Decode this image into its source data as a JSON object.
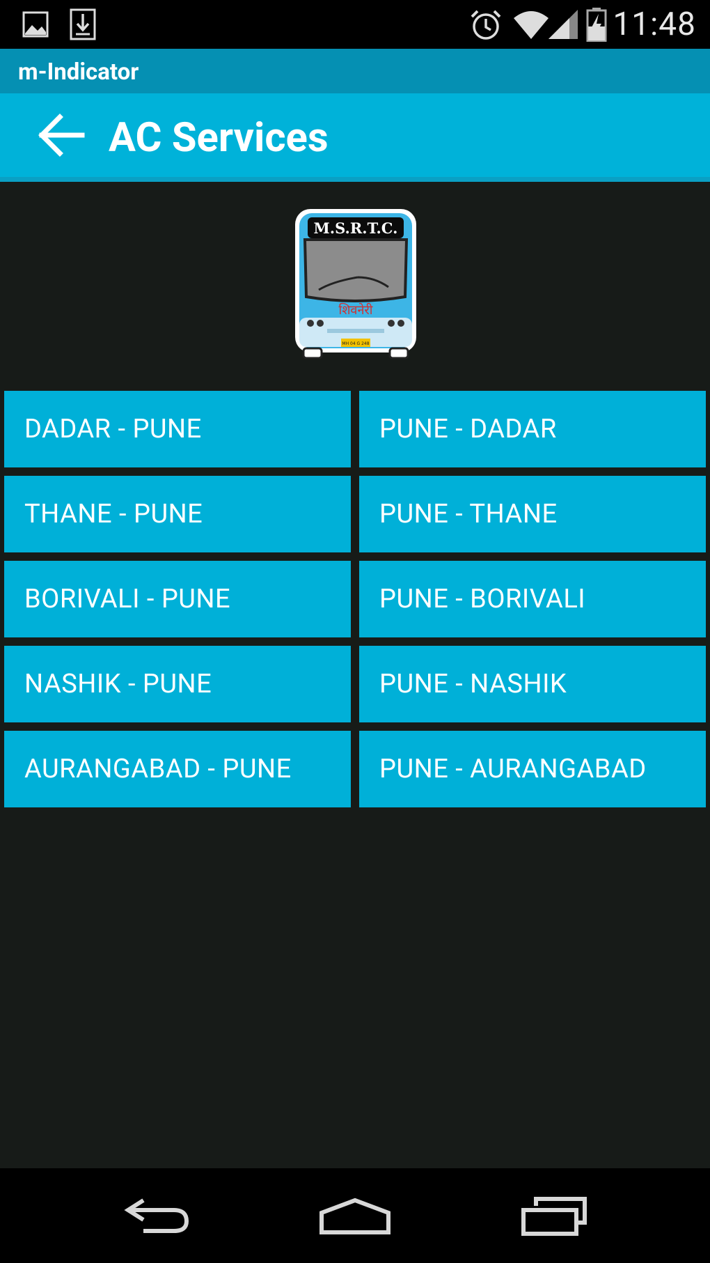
{
  "status_bar": {
    "time": "11:48",
    "icons": [
      "image-icon",
      "download-icon",
      "alarm-icon",
      "wifi-icon",
      "signal-icon",
      "battery-charging-icon"
    ]
  },
  "app": {
    "name": "m-Indicator"
  },
  "header": {
    "title": "AC Services",
    "back_icon": "back-arrow-icon"
  },
  "logo": {
    "name": "msrtc-bus-logo",
    "text": "M.S.R.T.C.",
    "subtext": "शिवनेरी",
    "plate": "MH 04 G 248"
  },
  "routes": [
    "DADAR - PUNE",
    "PUNE - DADAR",
    "THANE - PUNE",
    "PUNE - THANE",
    "BORIVALI - PUNE",
    "PUNE - BORIVALI",
    "NASHIK - PUNE",
    "PUNE - NASHIK",
    "AURANGABAD - PUNE",
    "PUNE - AURANGABAD"
  ],
  "nav_bar": {
    "buttons": [
      "back-nav-icon",
      "home-nav-icon",
      "recents-nav-icon"
    ]
  },
  "colors": {
    "accent": "#00b2d9",
    "app_bar": "#0590b3",
    "background": "#171b18",
    "button": "#00b0d8"
  }
}
